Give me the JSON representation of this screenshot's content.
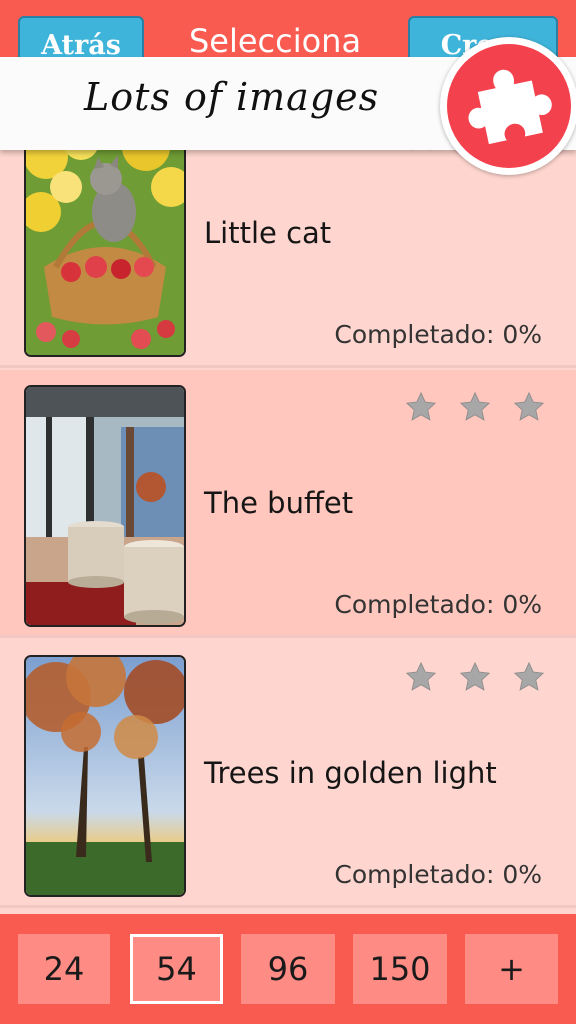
{
  "header": {
    "back_label": "Atrás",
    "title": "Selecciona",
    "create_label": "Crear"
  },
  "promo": {
    "text": "Lots of images",
    "logo_icon": "puzzle-piece-icon"
  },
  "puzzles": [
    {
      "title": "Little cat",
      "progress": "Completado: 0%",
      "stars": 3,
      "image": "kitten-in-apple-basket"
    },
    {
      "title": "The buffet",
      "progress": "Completado: 0%",
      "stars": 3,
      "image": "terrace-with-plate-stacks"
    },
    {
      "title": "Trees in golden light",
      "progress": "Completado: 0%",
      "stars": 3,
      "image": "autumn-trees-sunset"
    }
  ],
  "piece_counts": {
    "options": [
      "24",
      "54",
      "96",
      "150",
      "+"
    ],
    "selected": "54"
  },
  "colors": {
    "header_bg": "#fa5b50",
    "button_blue": "#3fb4da",
    "list_bg": "#ffd6cf",
    "alt_row_bg": "#ffc7bd",
    "piece_button": "#ff8c84",
    "logo_red": "#f4414e"
  }
}
